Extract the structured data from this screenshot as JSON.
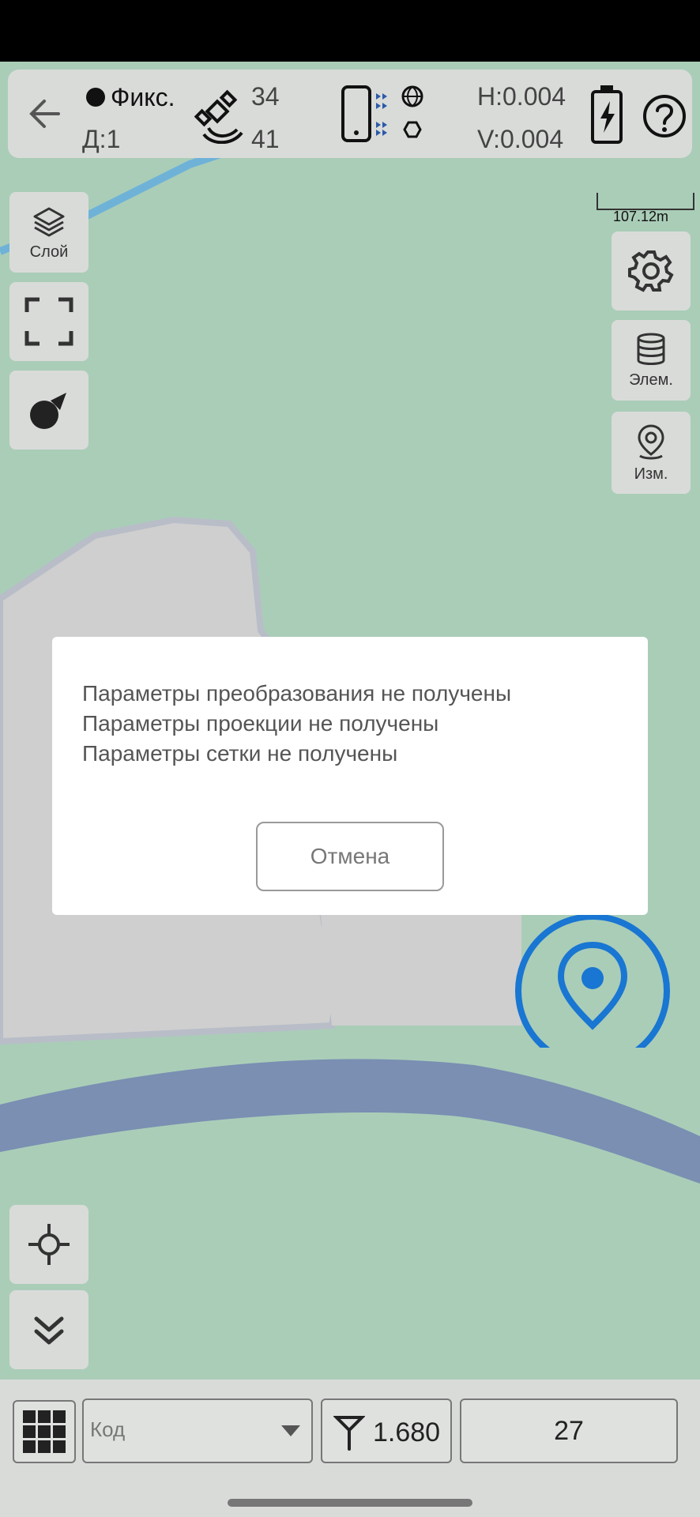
{
  "topbar": {
    "fix_status": "Фикс.",
    "diff_age": "Д:1",
    "sats_used": "34",
    "sats_visible": "41",
    "h_precision": "H:0.004",
    "v_precision": "V:0.004"
  },
  "left_panel": {
    "layers_label": "Слой"
  },
  "right_panel": {
    "elements_label": "Элем.",
    "measure_label": "Изм."
  },
  "scale_bar": "107.12m",
  "dialog": {
    "lines": [
      "Параметры преобразования не получены",
      "Параметры проекции не получены",
      "Параметры сетки не получены"
    ],
    "cancel_label": "Отмена"
  },
  "bottom": {
    "code_placeholder": "Код",
    "antenna_height": "1.680",
    "point_number": "27"
  },
  "colors": {
    "accent": "#1976d2",
    "map_green": "#aacdb8",
    "map_gray": "#cfcfcf",
    "road": "#7a8fb2"
  }
}
